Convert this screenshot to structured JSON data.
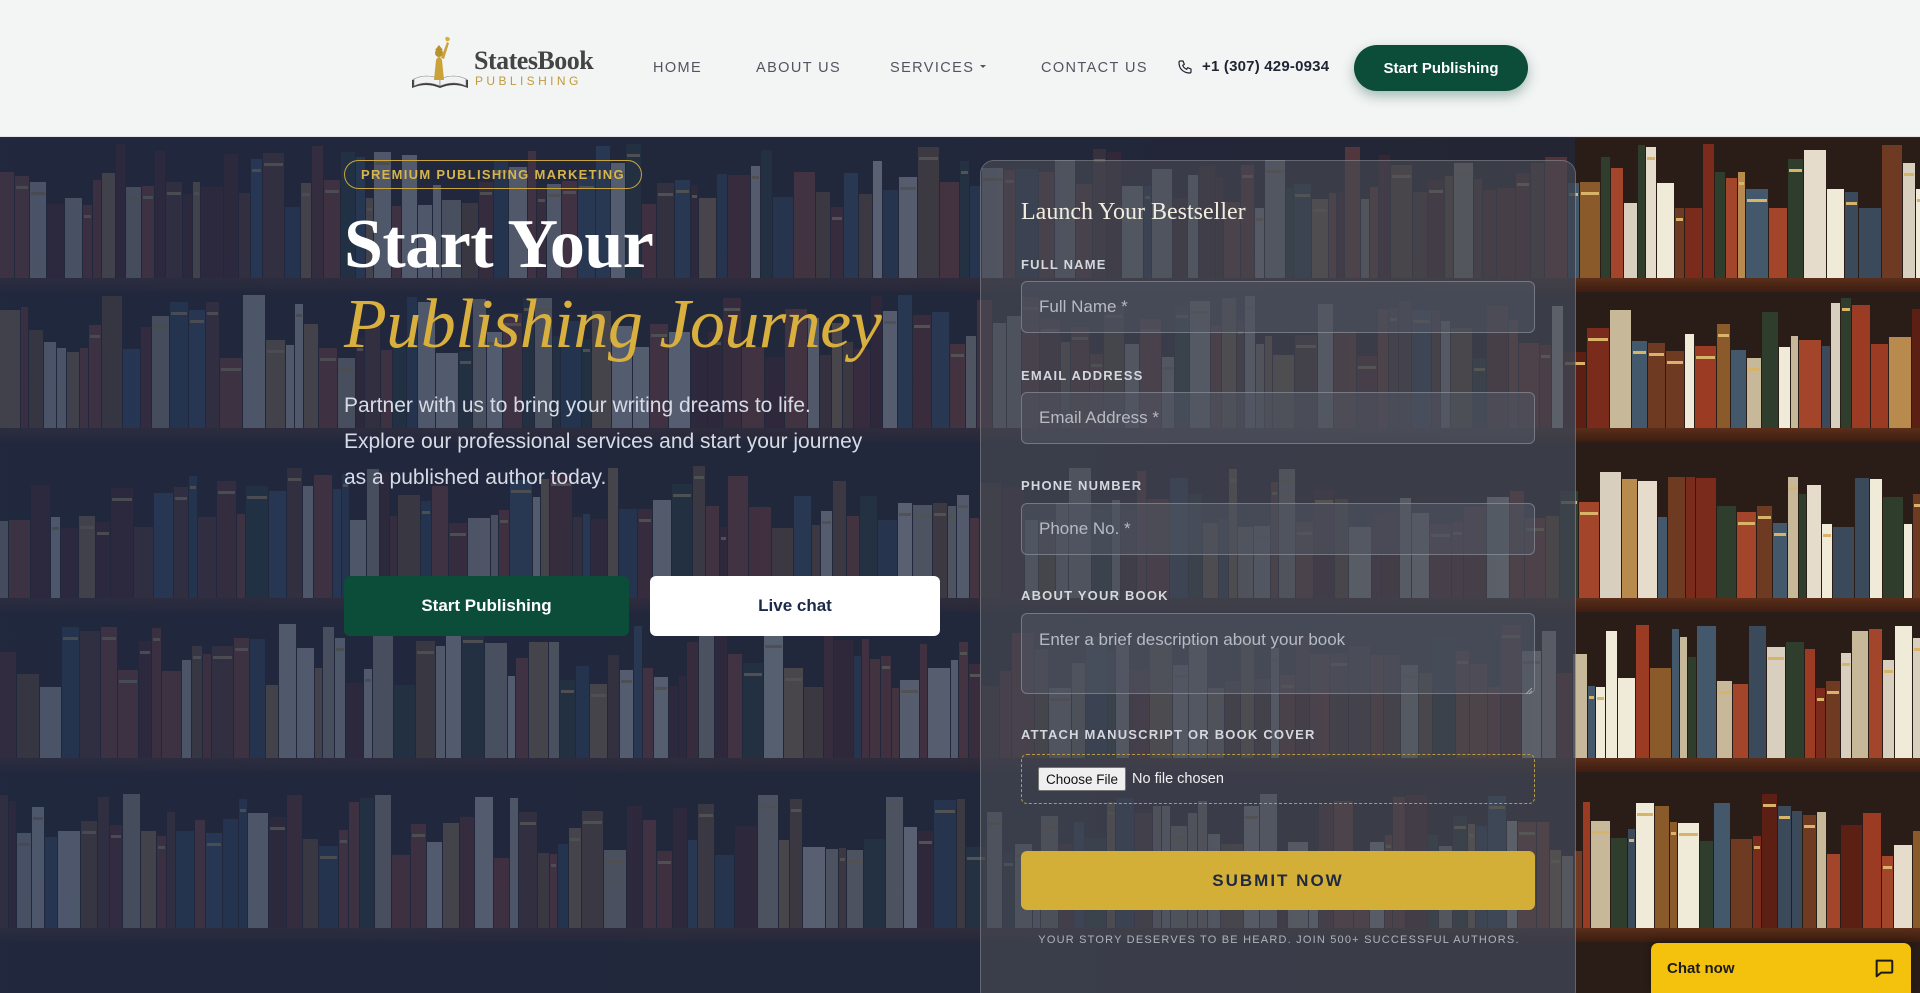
{
  "header": {
    "logo": {
      "name": "StatesBook",
      "sub": "PUBLISHING"
    },
    "nav": [
      "HOME",
      "ABOUT US",
      "SERVICES",
      "CONTACT US"
    ],
    "phone": "+1 (307) 429-0934",
    "cta": "Start Publishing"
  },
  "hero": {
    "badge": "PREMIUM PUBLISHING MARKETING",
    "title_line1": "Start Your",
    "title_line2": "Publishing Journey",
    "description": "Partner with us to bring your writing dreams to life. Explore our professional services and start your journey as a published author today.",
    "primary_button": "Start Publishing",
    "secondary_button": "Live chat"
  },
  "form": {
    "title": "Launch Your Bestseller",
    "full_name_label": "FULL NAME",
    "full_name_placeholder": "Full Name *",
    "email_label": "EMAIL ADDRESS",
    "email_placeholder": "Email Address *",
    "phone_label": "PHONE NUMBER",
    "phone_placeholder": "Phone No. *",
    "about_label": "ABOUT YOUR BOOK",
    "about_placeholder": "Enter a brief description about your book",
    "attach_label": "ATTACH MANUSCRIPT OR BOOK COVER",
    "file_button": "Choose File",
    "file_status": "No file chosen",
    "submit": "SUBMIT NOW",
    "footnote": "YOUR STORY DESERVES TO BE HEARD. JOIN 500+ SUCCESSFUL AUTHORS."
  },
  "chat": {
    "label": "Chat now",
    "icon": "chat-bubble-icon"
  },
  "colors": {
    "brand_green": "#0b4d38",
    "gold": "#d4af37",
    "navy": "#1e2c4a",
    "chat_yellow": "#f4c20d"
  }
}
